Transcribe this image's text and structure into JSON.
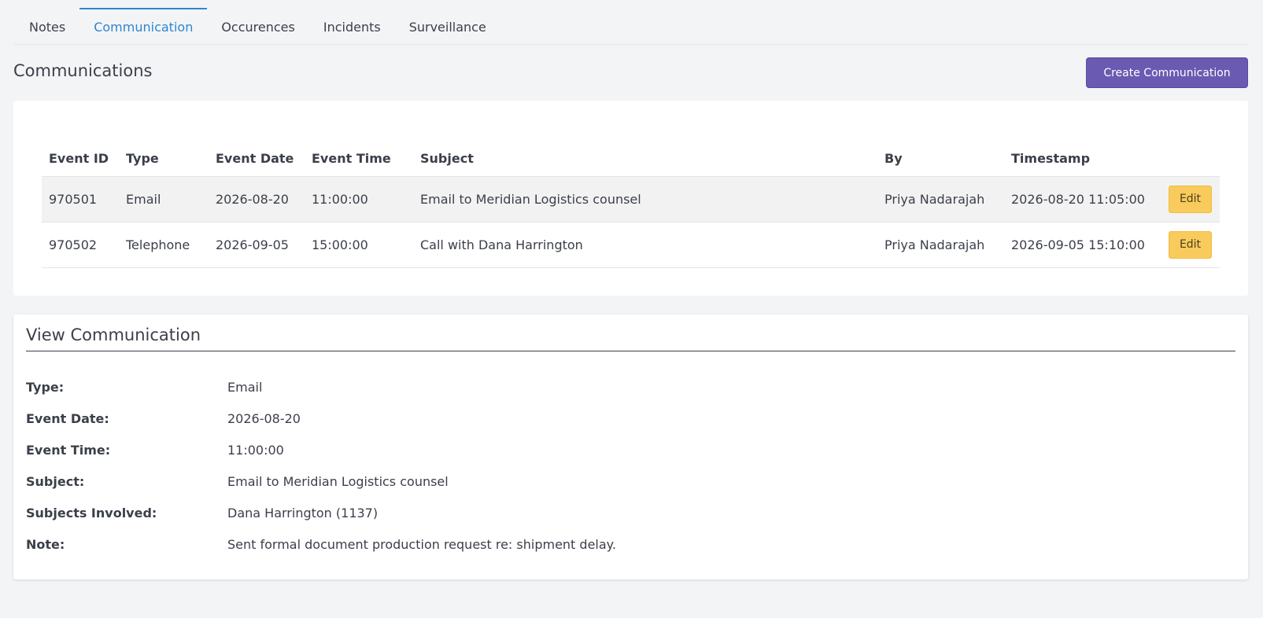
{
  "tabs": [
    {
      "label": "Notes"
    },
    {
      "label": "Communication"
    },
    {
      "label": "Occurences"
    },
    {
      "label": "Incidents"
    },
    {
      "label": "Surveillance"
    }
  ],
  "header": {
    "title": "Communications",
    "create_label": "Create Communication"
  },
  "table": {
    "columns": [
      "Event ID",
      "Type",
      "Event Date",
      "Event Time",
      "Subject",
      "By",
      "Timestamp"
    ],
    "rows": [
      {
        "event_id": "970501",
        "type": "Email",
        "event_date": "2026-08-20",
        "event_time": "11:00:00",
        "subject": "Email to Meridian Logistics counsel",
        "by": "Priya Nadarajah",
        "timestamp": "2026-08-20 11:05:00",
        "action": "Edit"
      },
      {
        "event_id": "970502",
        "type": "Telephone",
        "event_date": "2026-09-05",
        "event_time": "15:00:00",
        "subject": "Call with Dana Harrington",
        "by": "Priya Nadarajah",
        "timestamp": "2026-09-05 15:10:00",
        "action": "Edit"
      }
    ]
  },
  "view": {
    "title": "View Communication",
    "fields": [
      {
        "label": "Type:",
        "value": "Email"
      },
      {
        "label": "Event Date:",
        "value": "2026-08-20"
      },
      {
        "label": "Event Time:",
        "value": "11:00:00"
      },
      {
        "label": "Subject:",
        "value": "Email to Meridian Logistics counsel"
      },
      {
        "label": "Subjects Involved:",
        "value": "Dana Harrington (1137)"
      },
      {
        "label": "Note:",
        "value": "Sent formal document production request re: shipment delay."
      }
    ]
  },
  "colors": {
    "accent": "#2e86d0",
    "primary_button": "#6a5ab1",
    "edit_button": "#f9cb5c"
  }
}
